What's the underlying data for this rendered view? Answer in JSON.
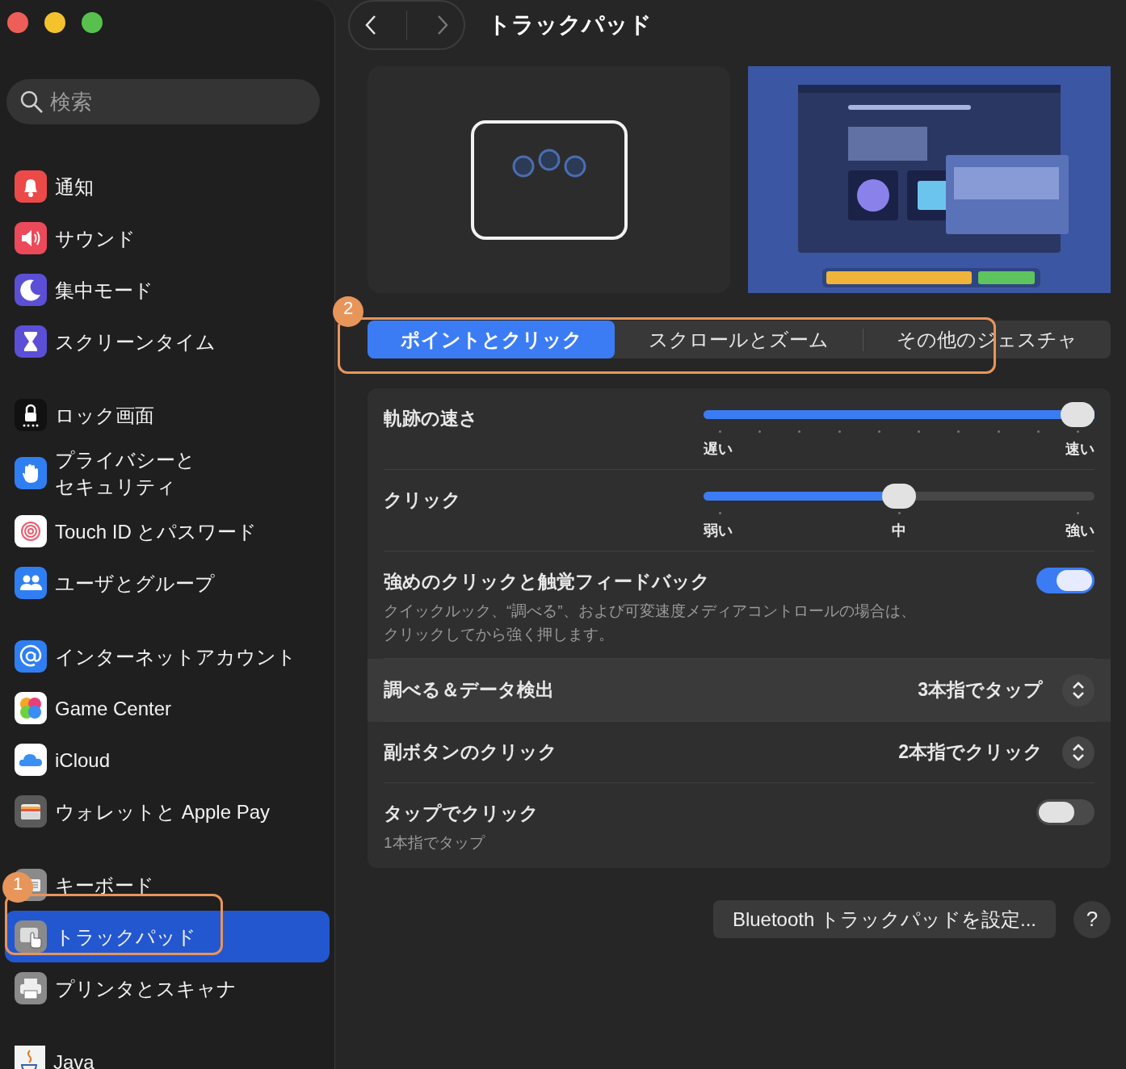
{
  "window": {
    "title": "トラックパッド"
  },
  "sidebar": {
    "search": {
      "placeholder": "検索"
    },
    "groups": [
      {
        "items": [
          {
            "label": "通知",
            "selected": false
          },
          {
            "label": "サウンド",
            "selected": false
          },
          {
            "label": "集中モード",
            "selected": false
          },
          {
            "label": "スクリーンタイム",
            "selected": false
          }
        ]
      },
      {
        "items": [
          {
            "label": "ロック画面",
            "selected": false
          },
          {
            "label": "プライバシーとセキュリティ",
            "selected": false
          },
          {
            "label": "Touch ID とパスワード",
            "selected": false
          },
          {
            "label": "ユーザとグループ",
            "selected": false
          }
        ]
      },
      {
        "items": [
          {
            "label": "インターネットアカウント",
            "selected": false
          },
          {
            "label": "Game Center",
            "selected": false
          },
          {
            "label": "iCloud",
            "selected": false
          },
          {
            "label": "ウォレットと Apple Pay",
            "selected": false
          }
        ]
      },
      {
        "items": [
          {
            "label": "キーボード",
            "selected": false
          },
          {
            "label": "トラックパッド",
            "selected": true
          },
          {
            "label": "プリンタとスキャナ",
            "selected": false
          }
        ]
      },
      {
        "items": [
          {
            "label": "Java",
            "selected": false
          }
        ]
      }
    ]
  },
  "tabs": [
    {
      "label": "ポイントとクリック",
      "selected": true
    },
    {
      "label": "スクロールとズーム",
      "selected": false
    },
    {
      "label": "その他のジェスチャ",
      "selected": false
    }
  ],
  "settings": [
    {
      "kind": "slider",
      "label": "軌跡の速さ",
      "level": 1,
      "tick_labels": [
        "遅い",
        "速い"
      ]
    },
    {
      "kind": "slider",
      "label": "クリック",
      "level": 0.5,
      "tick_labels": [
        "弱い",
        "中",
        "強い"
      ]
    },
    {
      "kind": "toggle",
      "label": "強めのクリックと触覚フィードバック",
      "description": "クイックルック、“調べる”、および可変速度メディアコントロールの場合は、クリックしてから強く押します。",
      "on": true
    },
    {
      "kind": "popup",
      "label": "調べる＆データ検出",
      "value": "3本指でタップ",
      "selected": true
    },
    {
      "kind": "popup",
      "label": "副ボタンのクリック",
      "value": "2本指でクリック",
      "selected": false
    },
    {
      "kind": "toggle",
      "label": "タップでクリック",
      "description": "1本指でタップ",
      "on": false
    }
  ],
  "footer": {
    "button": "Bluetooth トラックパッドを設定...",
    "help": "?"
  },
  "annotations": [
    {
      "label": "1"
    },
    {
      "label": "2"
    }
  ]
}
